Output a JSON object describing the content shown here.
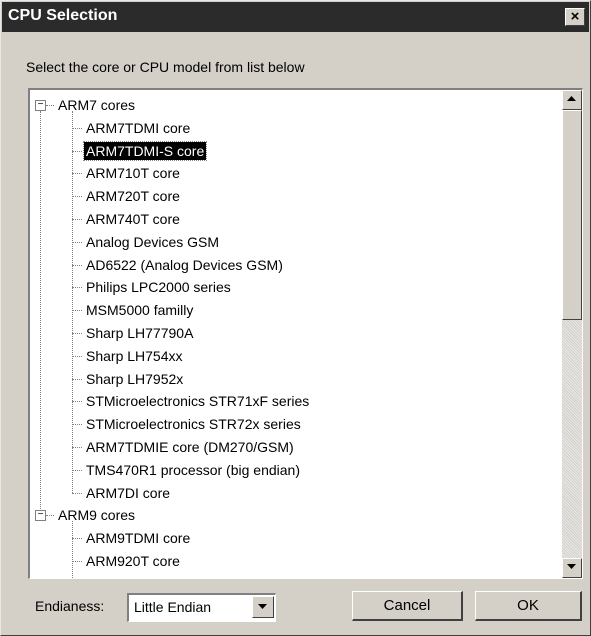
{
  "window": {
    "title": "CPU Selection",
    "close_glyph": "×"
  },
  "prompt": "Select the core or CPU model from list below",
  "tree": {
    "items": [
      {
        "label": "ARM7 cores",
        "level": 0,
        "expanded": true
      },
      {
        "label": "ARM7TDMI core",
        "level": 1
      },
      {
        "label": "ARM7TDMI-S core",
        "level": 1,
        "selected": true
      },
      {
        "label": "ARM710T core",
        "level": 1
      },
      {
        "label": "ARM720T core",
        "level": 1
      },
      {
        "label": "ARM740T core",
        "level": 1
      },
      {
        "label": "Analog Devices GSM",
        "level": 1
      },
      {
        "label": "AD6522 (Analog Devices GSM)",
        "level": 1
      },
      {
        "label": "Philips LPC2000 series",
        "level": 1
      },
      {
        "label": "MSM5000 familly",
        "level": 1
      },
      {
        "label": "Sharp LH77790A",
        "level": 1
      },
      {
        "label": "Sharp LH754xx",
        "level": 1
      },
      {
        "label": "Sharp LH7952x",
        "level": 1
      },
      {
        "label": "STMicroelectronics STR71xF series",
        "level": 1
      },
      {
        "label": "STMicroelectronics STR72x series",
        "level": 1
      },
      {
        "label": "ARM7TDMIE core (DM270/GSM)",
        "level": 1
      },
      {
        "label": "TMS470R1 processor (big endian)",
        "level": 1
      },
      {
        "label": "ARM7DI core",
        "level": 1
      },
      {
        "label": "ARM9 cores",
        "level": 0,
        "expanded": true
      },
      {
        "label": "ARM9TDMI core",
        "level": 1
      },
      {
        "label": "ARM920T core",
        "level": 1
      }
    ]
  },
  "endianness": {
    "label": "Endianess:",
    "value": "Little Endian"
  },
  "buttons": {
    "cancel": "Cancel",
    "ok": "OK"
  },
  "icons": {
    "close": "close-icon",
    "expander": "minus-box-icon",
    "scroll_up": "arrow-up-icon",
    "scroll_down": "arrow-down-icon",
    "dropdown": "chevron-down-icon"
  }
}
